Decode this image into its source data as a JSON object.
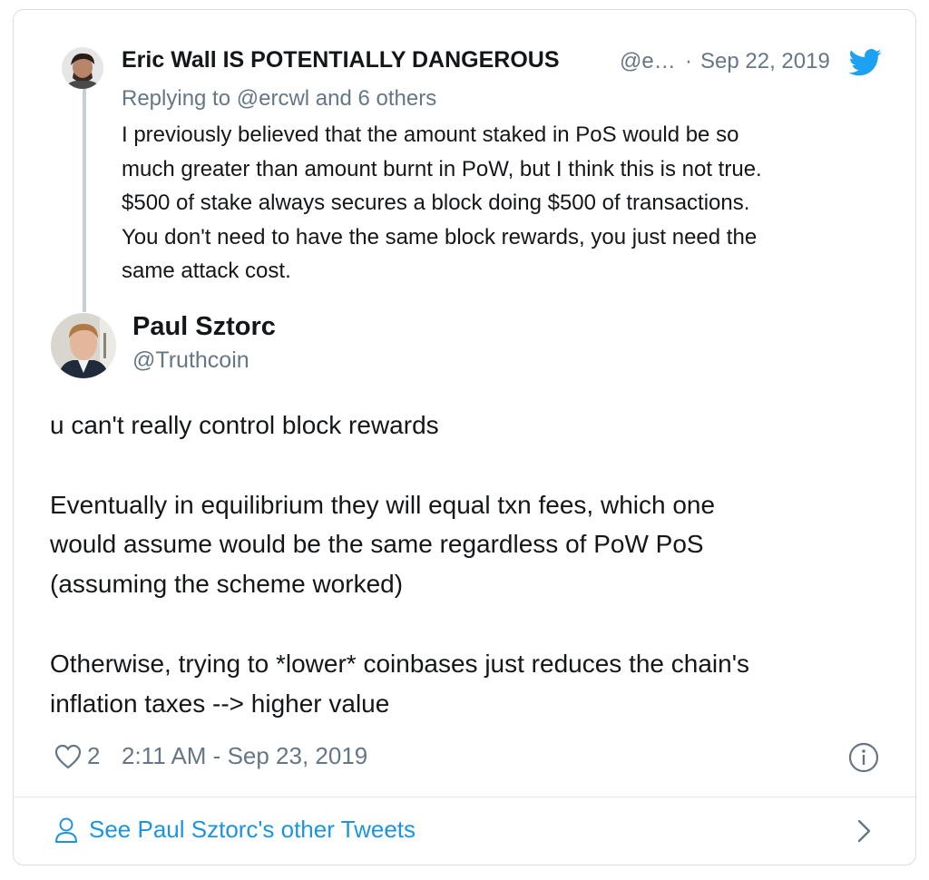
{
  "quoted_tweet": {
    "author_name": "Eric Wall IS POTENTIALLY DANGEROUS",
    "author_handle": "@e…",
    "separator": "·",
    "date": "Sep 22, 2019",
    "replying_to": "Replying to @ercwl and 6 others",
    "text_lines": [
      "I previously believed that the amount staked in PoS would be so",
      "much greater than amount burnt in PoW, but I think this is not true.",
      "$500 of stake always secures a block doing $500 of transactions.",
      "You don't need to have the same block rewards, you just need the",
      "same attack cost."
    ]
  },
  "main_tweet": {
    "author_name": "Paul Sztorc",
    "author_handle": "@Truthcoin",
    "text_lines": [
      "u can't really control block rewards",
      "",
      "Eventually in equilibrium they will equal txn fees, which one",
      "would assume would be the same regardless of PoW PoS",
      "(assuming the scheme worked)",
      "",
      "Otherwise, trying to *lower* coinbases just reduces the chain's",
      "inflation taxes --> higher value"
    ],
    "like_count": "2",
    "timestamp": "2:11 AM - Sep 23, 2019"
  },
  "footer": {
    "see_more_label": "See Paul Sztorc's other Tweets"
  },
  "icons": {
    "bird": "twitter-bird-icon",
    "heart": "heart-icon",
    "info": "info-icon",
    "person": "person-icon",
    "chevron": "chevron-right-icon"
  },
  "colors": {
    "text": "#14171a",
    "muted": "#657786",
    "link": "#1b95e0",
    "twitter_blue": "#1da1f2",
    "thread_line": "#c4cfd6"
  }
}
